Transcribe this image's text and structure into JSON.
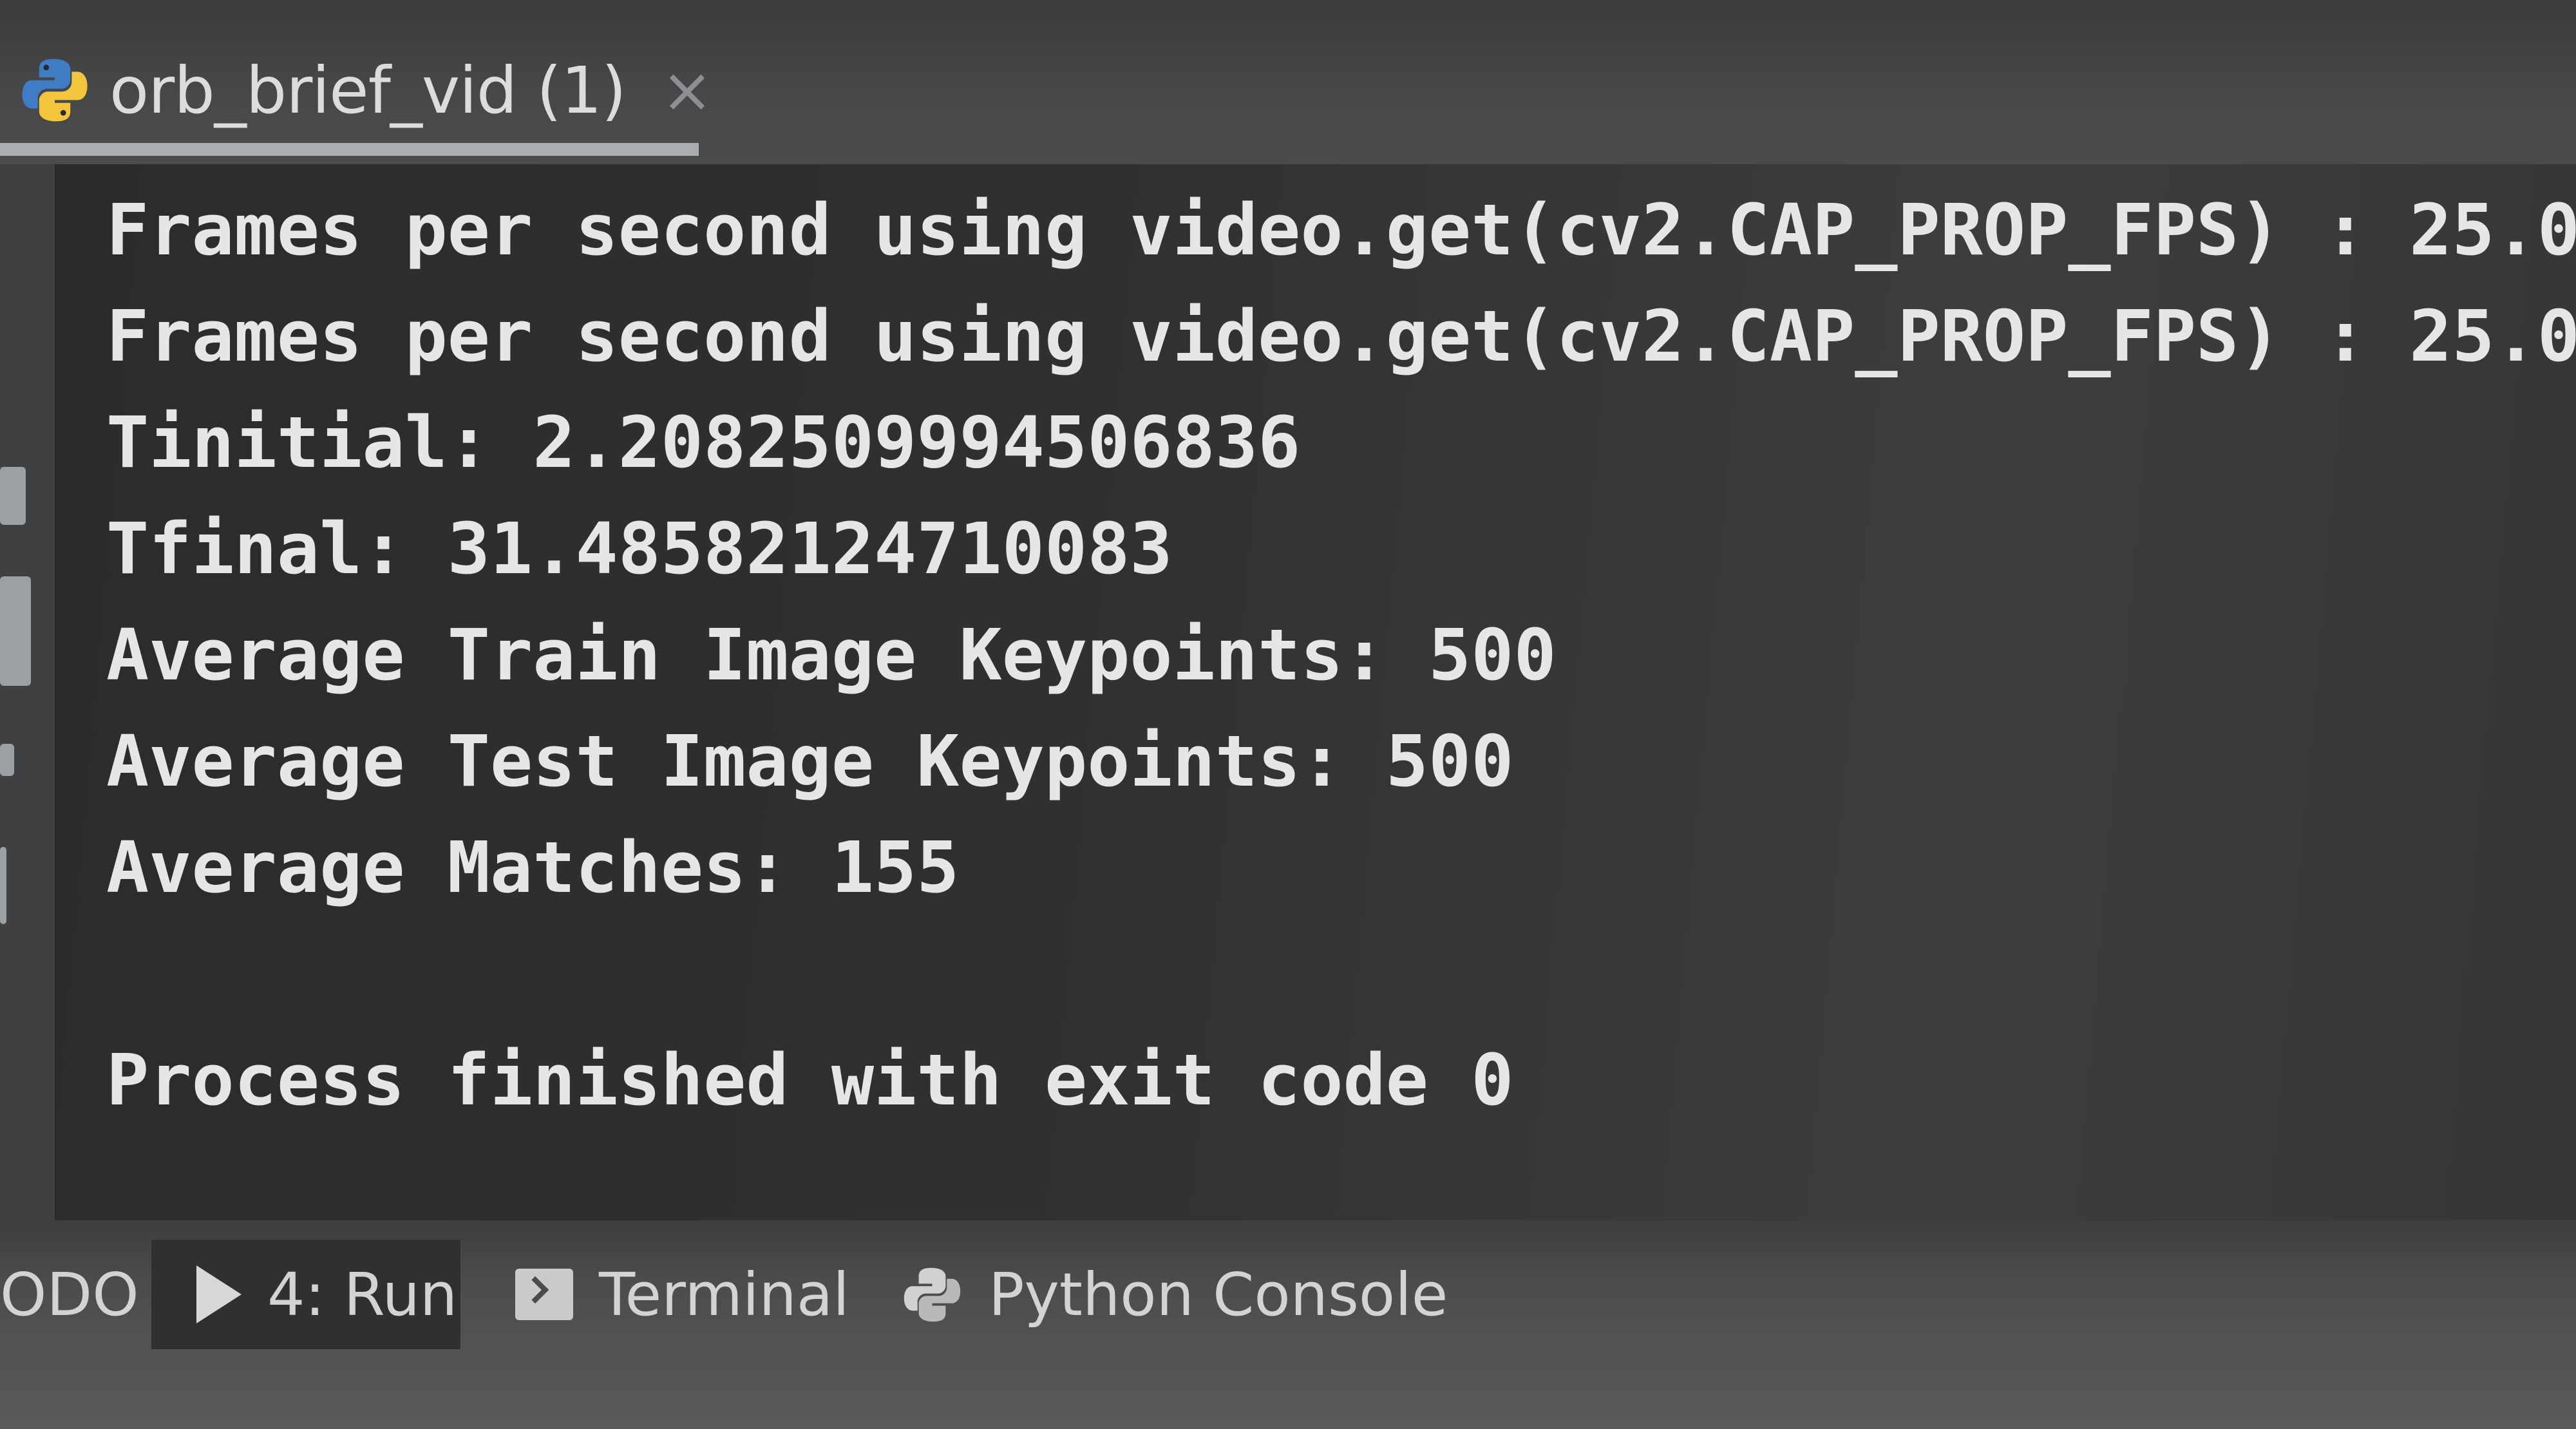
{
  "tab": {
    "title": "orb_brief_vid (1)",
    "close_glyph": "×",
    "icon": "python-icon"
  },
  "console": {
    "lines": [
      "Frames per second using video.get(cv2.CAP_PROP_FPS) : 25.0",
      "Frames per second using video.get(cv2.CAP_PROP_FPS) : 25.0",
      "Tinitial: 2.2082509994506836",
      "Tfinal: 31.48582124710083",
      "Average Train Image Keypoints: 500",
      "Average Test Image Keypoints: 500",
      "Average Matches: 155",
      "",
      "Process finished with exit code 0"
    ]
  },
  "toolbar": {
    "todo_label": "ODO",
    "run_label": "4: Run",
    "run_icon": "play-icon",
    "terminal_label": "Terminal",
    "terminal_icon": "terminal-icon",
    "python_console_label": "Python Console",
    "python_console_icon": "python-icon"
  },
  "colors": {
    "console_bg": "#2f3032",
    "console_text": "#e6e6e6",
    "python_blue": "#3f7cc4",
    "python_yellow": "#f2c53d"
  }
}
